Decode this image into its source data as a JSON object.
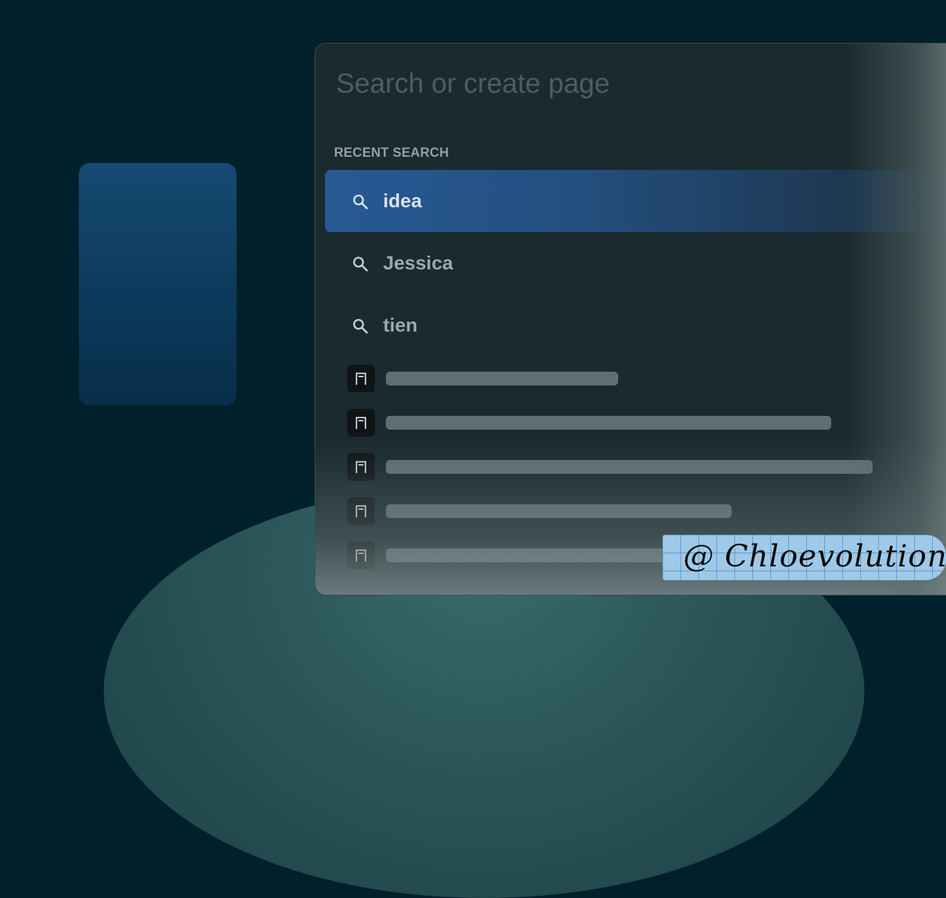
{
  "search": {
    "placeholder": "Search or create page",
    "value": ""
  },
  "recent": {
    "heading": "RECENT SEARCH",
    "items": [
      {
        "label": "idea",
        "active": true
      },
      {
        "label": "Jessica",
        "active": false
      },
      {
        "label": "tien",
        "active": false
      }
    ]
  },
  "pages": {
    "count_shown": 5
  },
  "watermark": {
    "text": "@ Chloevolution"
  },
  "colors": {
    "background": "#00212b",
    "palette": "#1a2a2e",
    "active_row": "#275a93",
    "side_card": "#164a72",
    "placeholder_bar": "#5e6e71",
    "watermark_bg": "#9ec9e8"
  },
  "icons": {
    "recent": "search-icon",
    "page": "page-doc-icon"
  }
}
